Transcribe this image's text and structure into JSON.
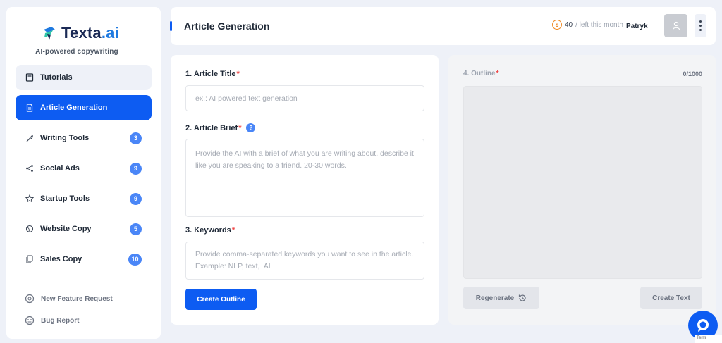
{
  "brand": {
    "name_main": "Texta",
    "name_suffix": ".ai",
    "tagline": "AI-powered copywriting"
  },
  "sidebar": {
    "items": [
      {
        "label": "Tutorials",
        "icon": "book-icon",
        "badge": ""
      },
      {
        "label": "Article Generation",
        "icon": "document-icon",
        "badge": ""
      },
      {
        "label": "Writing Tools",
        "icon": "feather-icon",
        "badge": "3"
      },
      {
        "label": "Social Ads",
        "icon": "share-icon",
        "badge": "9"
      },
      {
        "label": "Startup Tools",
        "icon": "star-icon",
        "badge": "9"
      },
      {
        "label": "Website Copy",
        "icon": "globe-icon",
        "badge": "5"
      },
      {
        "label": "Sales Copy",
        "icon": "copy-icon",
        "badge": "10"
      }
    ],
    "footer": {
      "feature_request": "New Feature Request",
      "bug_report": "Bug Report"
    }
  },
  "header": {
    "title": "Article Generation",
    "credits_count": "40",
    "credits_text": "/ left this month",
    "user_name": "Patryk"
  },
  "form": {
    "title_label": "1. Article Title",
    "title_placeholder": "ex.: AI powered text generation",
    "brief_label": "2. Article Brief",
    "brief_help": "?",
    "brief_placeholder": "Provide the AI with a brief of what you are writing about, describe it like you are speaking to a friend. 20-30 words.",
    "keywords_label": "3. Keywords",
    "keywords_placeholder": "Provide comma-separated keywords you want to see in the article. Example: NLP, text,  AI",
    "create_outline": "Create Outline",
    "required_mark": "*"
  },
  "outline": {
    "label": "4. Outline",
    "counter": "0/1000",
    "regenerate": "Regenerate",
    "create_text": "Create Text"
  },
  "terms": "Term",
  "colors": {
    "primary": "#0d5cf2",
    "badge": "#4a86f7",
    "coin": "#f08a24",
    "required": "#ef4444"
  }
}
